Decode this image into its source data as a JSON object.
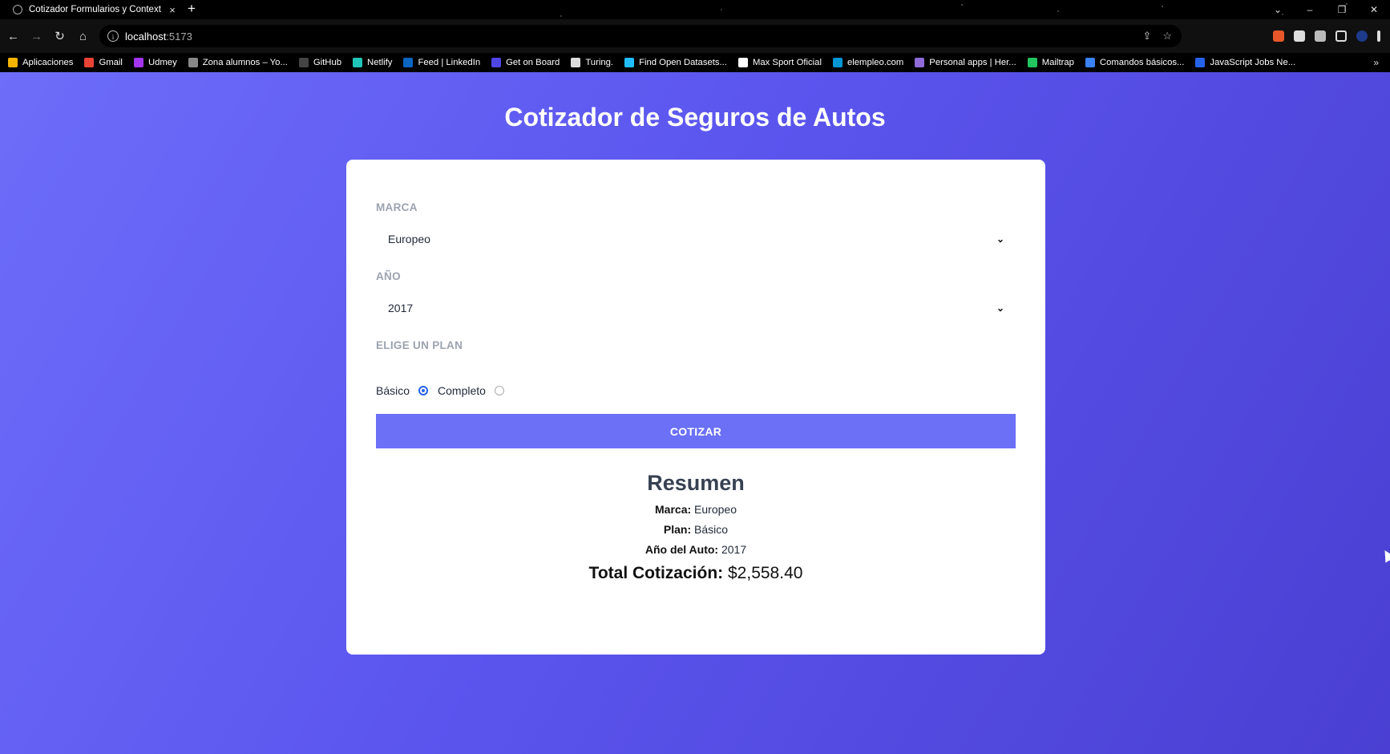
{
  "browser": {
    "tab_title": "Cotizador Formularios y Context",
    "tab_close": "×",
    "new_tab": "+",
    "url_host": "localhost",
    "url_port": ":5173",
    "bookmarks": [
      {
        "label": "Aplicaciones",
        "color": "#f4b400"
      },
      {
        "label": "Gmail",
        "color": "#ea4335"
      },
      {
        "label": "Udmey",
        "color": "#a435f0"
      },
      {
        "label": "Zona alumnos – Yo...",
        "color": "#888888"
      },
      {
        "label": "GitHub",
        "color": "#444444"
      },
      {
        "label": "Netlify",
        "color": "#20c6b7"
      },
      {
        "label": "Feed | LinkedIn",
        "color": "#0a66c2"
      },
      {
        "label": "Get on Board",
        "color": "#4f46e5"
      },
      {
        "label": "Turing.",
        "color": "#dddddd"
      },
      {
        "label": "Find Open Datasets...",
        "color": "#20beff"
      },
      {
        "label": "Max Sport Oficial",
        "color": "#ffffff"
      },
      {
        "label": "elempleo.com",
        "color": "#0096d6"
      },
      {
        "label": "Personal apps | Her...",
        "color": "#8e6bd8"
      },
      {
        "label": "Mailtrap",
        "color": "#22c55e"
      },
      {
        "label": "Comandos básicos...",
        "color": "#3b82f6"
      },
      {
        "label": "JavaScript Jobs Ne...",
        "color": "#2563eb"
      }
    ],
    "bookmarks_more": "»"
  },
  "page": {
    "title": "Cotizador de Seguros de Autos"
  },
  "form": {
    "marca_label": "Marca",
    "marca_value": "Europeo",
    "ano_label": "Año",
    "ano_value": "2017",
    "plan_label": "Elige un Plan",
    "plan_options": [
      {
        "label": "Básico",
        "selected": true
      },
      {
        "label": "Completo",
        "selected": false
      }
    ],
    "submit_label": "Cotizar"
  },
  "summary": {
    "title": "Resumen",
    "marca_key": "Marca:",
    "marca_val": "Europeo",
    "plan_key": "Plan:",
    "plan_val": "Básico",
    "ano_key": "Año del Auto:",
    "ano_val": "2017",
    "total_key": "Total Cotización:",
    "total_val": "$2,558.40"
  }
}
